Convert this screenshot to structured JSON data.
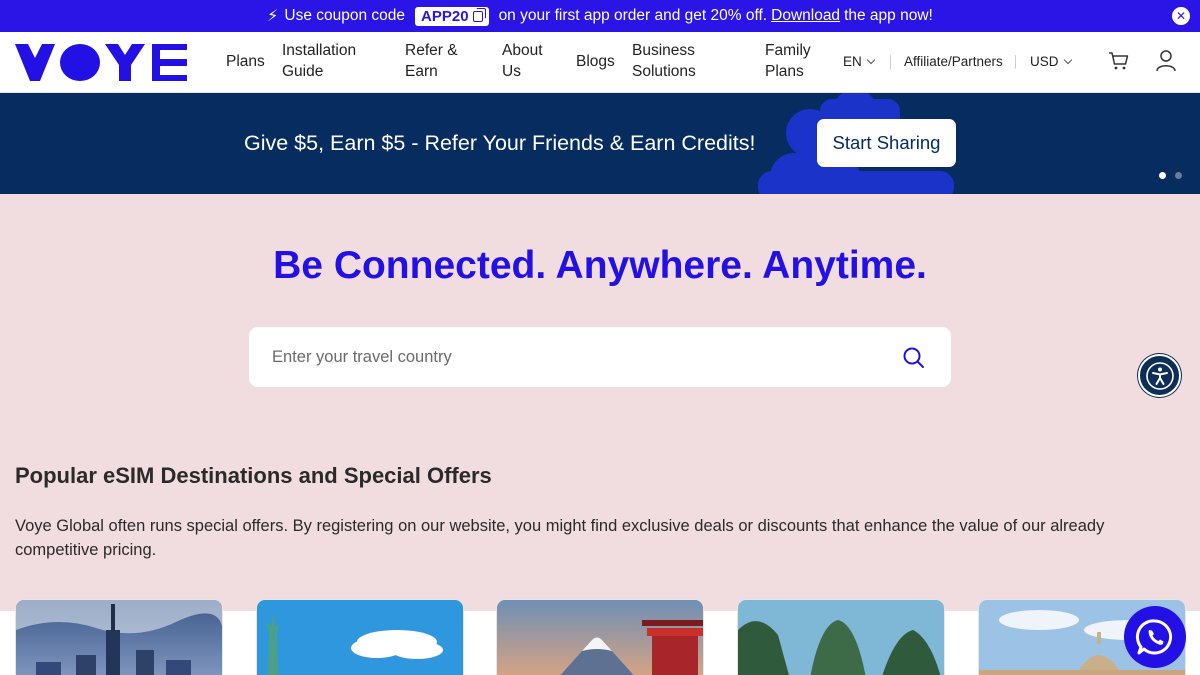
{
  "promo": {
    "prefix": "Use coupon code",
    "code": "APP20",
    "middle": "on your first app order and get 20% off.",
    "link": "Download",
    "suffix": "the app now!"
  },
  "header": {
    "logo_text": "VOYE",
    "nav": {
      "plans": "Plans",
      "installation_line1": "Installation",
      "installation_line2": "Guide",
      "refer_line1": "Refer &",
      "refer_line2": "Earn",
      "about_line1": "About",
      "about_line2": "Us",
      "blogs": "Blogs",
      "business_line1": "Business",
      "business_line2": "Solutions",
      "family_line1": "Family",
      "family_line2": "Plans"
    },
    "language": "EN",
    "affiliate": "Affiliate/Partners",
    "currency": "USD"
  },
  "banner": {
    "text": "Give $5, Earn $5 - Refer Your Friends & Earn Credits!",
    "button": "Start Sharing",
    "slides": 2,
    "active_slide": 1
  },
  "hero": {
    "title": "Be Connected. Anywhere. Anytime.",
    "search_placeholder": "Enter your travel country"
  },
  "destinations": {
    "title": "Popular eSIM Destinations and Special Offers",
    "description": "Voye Global often runs special offers. By registering on our website, you might find exclusive deals or discounts that enhance the value of our already competitive pricing."
  },
  "colors": {
    "brand": "#2310e4",
    "promo_bar": "#2b14e6",
    "banner": "#062c60",
    "page_bg": "#f1dcdf"
  }
}
